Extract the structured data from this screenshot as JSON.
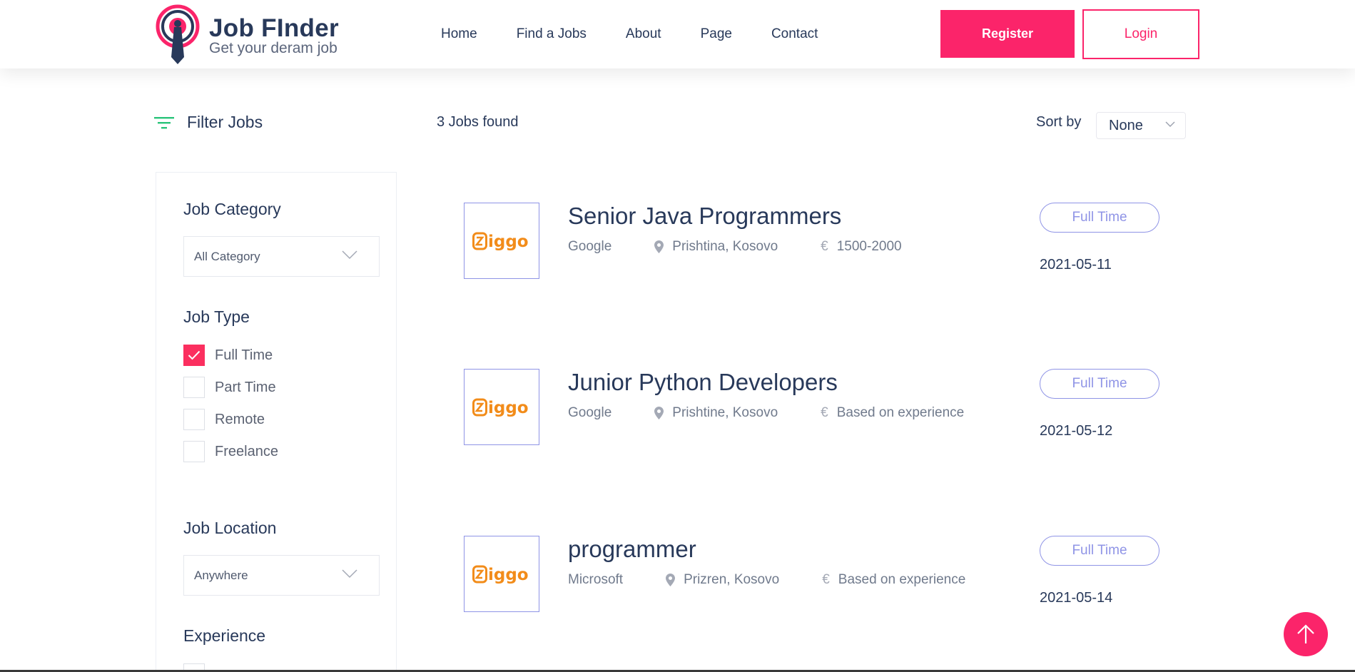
{
  "header": {
    "logo_title": "Job FInder",
    "logo_subtitle": "Get your deram job",
    "nav": [
      "Home",
      "Find a Jobs",
      "About",
      "Page",
      "Contact"
    ],
    "register_label": "Register",
    "login_label": "Login"
  },
  "toolbar": {
    "filter_title": "Filter Jobs",
    "jobs_found": "3 Jobs found",
    "sort_label": "Sort by",
    "sort_value": "None"
  },
  "sidebar": {
    "category_heading": "Job Category",
    "category_value": "All Category",
    "type_heading": "Job Type",
    "types": [
      {
        "label": "Full Time",
        "checked": true
      },
      {
        "label": "Part Time",
        "checked": false
      },
      {
        "label": "Remote",
        "checked": false
      },
      {
        "label": "Freelance",
        "checked": false
      }
    ],
    "location_heading": "Job Location",
    "location_value": "Anywhere",
    "experience_heading": "Experience"
  },
  "jobs": [
    {
      "logo_text": "Ziggo",
      "title": "Senior Java Programmers",
      "company": "Google",
      "location": "Prishtina, Kosovo",
      "currency": "€",
      "salary": "1500-2000",
      "type": "Full Time",
      "date": "2021-05-11"
    },
    {
      "logo_text": "Ziggo",
      "title": "Junior Python Developers",
      "company": "Google",
      "location": "Prishtine, Kosovo",
      "currency": "€",
      "salary": "Based on experience",
      "type": "Full Time",
      "date": "2021-05-12"
    },
    {
      "logo_text": "Ziggo",
      "title": "programmer",
      "company": "Microsoft",
      "location": "Prizren, Kosovo",
      "currency": "€",
      "salary": "Based on experience",
      "type": "Full Time",
      "date": "2021-05-14"
    }
  ],
  "colors": {
    "accent": "#fb246a",
    "checkbox": "#fb2f5f",
    "badge": "#8f94e6",
    "text": "#28395a",
    "logo_orange": "#f28c1a"
  }
}
